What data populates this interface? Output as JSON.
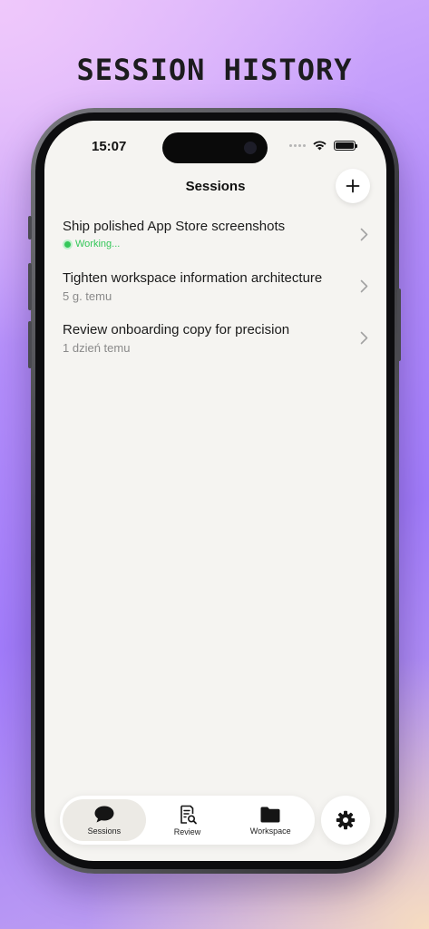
{
  "headline": "SESSION HISTORY",
  "status_bar": {
    "time": "15:07"
  },
  "header": {
    "title": "Sessions"
  },
  "sessions": [
    {
      "title": "Ship polished App Store screenshots",
      "status": "Working...",
      "state": "working"
    },
    {
      "title": "Tighten workspace information architecture",
      "status": "5 g. temu",
      "state": "idle"
    },
    {
      "title": "Review onboarding copy for precision",
      "status": "1 dzień temu",
      "state": "idle"
    }
  ],
  "tabbar": {
    "tabs": [
      {
        "label": "Sessions",
        "icon": "chat-bubble-icon",
        "active": true
      },
      {
        "label": "Review",
        "icon": "document-search-icon",
        "active": false
      },
      {
        "label": "Workspace",
        "icon": "folder-icon",
        "active": false
      }
    ]
  },
  "icons": {
    "add": "plus-icon",
    "settings": "gear-icon",
    "row": "chevron-right-icon"
  },
  "colors": {
    "working": "#34c759",
    "screen_bg": "#f5f4f1"
  }
}
